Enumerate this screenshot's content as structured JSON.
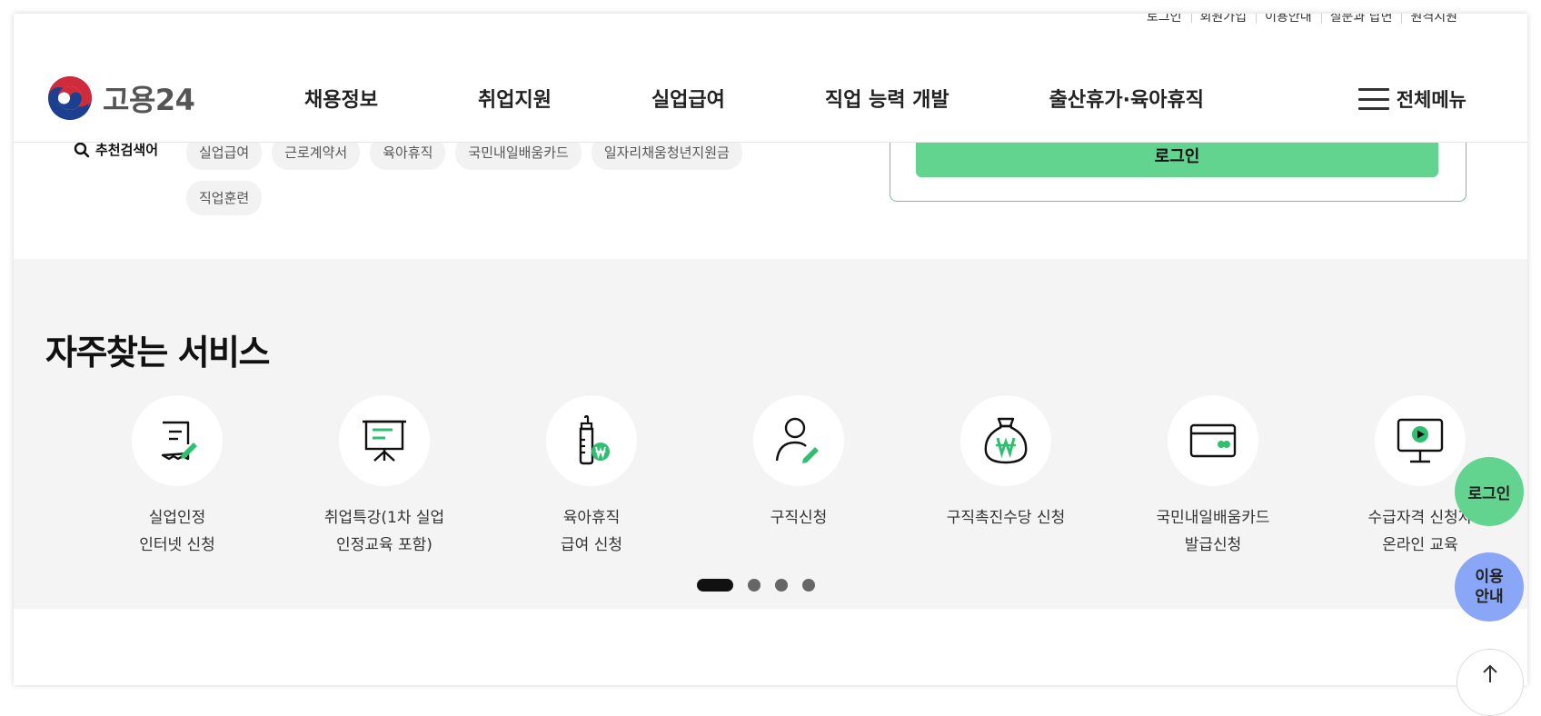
{
  "util_links": [
    "로그인",
    "회원가입",
    "이용안내",
    "질문과 답변",
    "원격지원"
  ],
  "logo": {
    "text": "고용24"
  },
  "gnb": [
    "채용정보",
    "취업지원",
    "실업급여",
    "직업 능력 개발",
    "출산휴가·육아휴직"
  ],
  "all_menu": "전체메뉴",
  "recommended": {
    "label": "추천검색어",
    "tags": [
      "실업급여",
      "근로계약서",
      "육아휴직",
      "국민내일배움카드",
      "일자리채움청년지원금",
      "직업훈련"
    ]
  },
  "login_box": {
    "button": "로그인"
  },
  "services": {
    "title": "자주찾는 서비스",
    "items": [
      {
        "label": "실업인정\n인터넷 신청",
        "icon": "document-edit-icon"
      },
      {
        "label": "취업특강(1차 실업\n인정교육 포함)",
        "icon": "presentation-board-icon"
      },
      {
        "label": "육아휴직\n급여 신청",
        "icon": "baby-bottle-won-icon"
      },
      {
        "label": "구직신청",
        "icon": "person-edit-icon"
      },
      {
        "label": "구직촉진수당 신청",
        "icon": "money-bag-won-icon"
      },
      {
        "label": "국민내일배움카드\n발급신청",
        "icon": "credit-card-icon"
      },
      {
        "label": "수급자격 신청자\n온라인 교육",
        "icon": "monitor-play-icon"
      }
    ],
    "pagination": {
      "total": 4,
      "current": 1
    }
  },
  "floating": {
    "login": "로그인",
    "guide": [
      "이용",
      "안내"
    ],
    "top_icon": "arrow-up-icon"
  },
  "colors": {
    "accent_green": "#63d490",
    "guide_blue": "#8aa6f7",
    "section_bg": "#f4f4f4"
  }
}
